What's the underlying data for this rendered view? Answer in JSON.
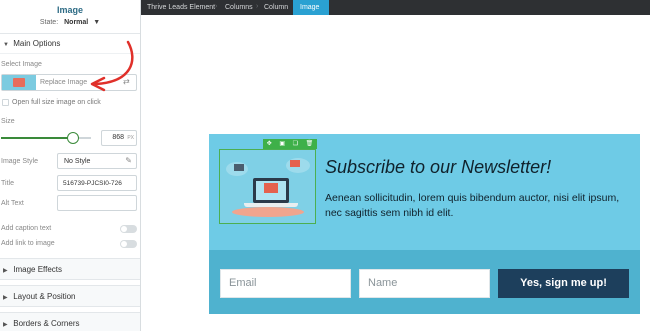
{
  "panel": {
    "title": "Image",
    "state_label": "State:",
    "state_value": "Normal",
    "main_options": "Main Options",
    "select_image": "Select Image",
    "replace_image": "Replace Image",
    "open_full_size": "Open full size image on click",
    "size_label": "Size",
    "size_value": "868",
    "size_unit": "PX",
    "size_slider_fraction": 0.8,
    "image_style_label": "Image Style",
    "image_style_value": "No Style",
    "title_label": "Title",
    "title_value": "516739-PJCSI0-726",
    "alt_label": "Alt Text",
    "alt_value": "",
    "caption_label": "Add caption text",
    "link_label": "Add link to image",
    "caption_on": false,
    "link_on": false,
    "sections": {
      "effects": "Image Effects",
      "layout": "Layout & Position",
      "borders": "Borders & Corners"
    }
  },
  "breadcrumbs": [
    "Thrive Leads Element",
    "Columns",
    "Column",
    "Image"
  ],
  "newsletter": {
    "title": "Subscribe to our Newsletter!",
    "body": "Aenean sollicitudin, lorem quis bibendum auctor, nisi elit ipsum, nec sagittis sem nibh id elit.",
    "email_placeholder": "Email",
    "name_placeholder": "Name",
    "submit_label": "Yes, sign me up!"
  },
  "icons": {
    "toolbar": [
      "move-icon",
      "duplicate-icon",
      "copy-icon",
      "delete-icon"
    ]
  },
  "colors": {
    "accent": "#2aa1d2",
    "newsletter_bg": "#6ecbe6",
    "newsletter_footer": "#4fb2cf",
    "button": "#1d3f5c",
    "toolbar": "#3eb049",
    "arrow": "#e0302a"
  }
}
